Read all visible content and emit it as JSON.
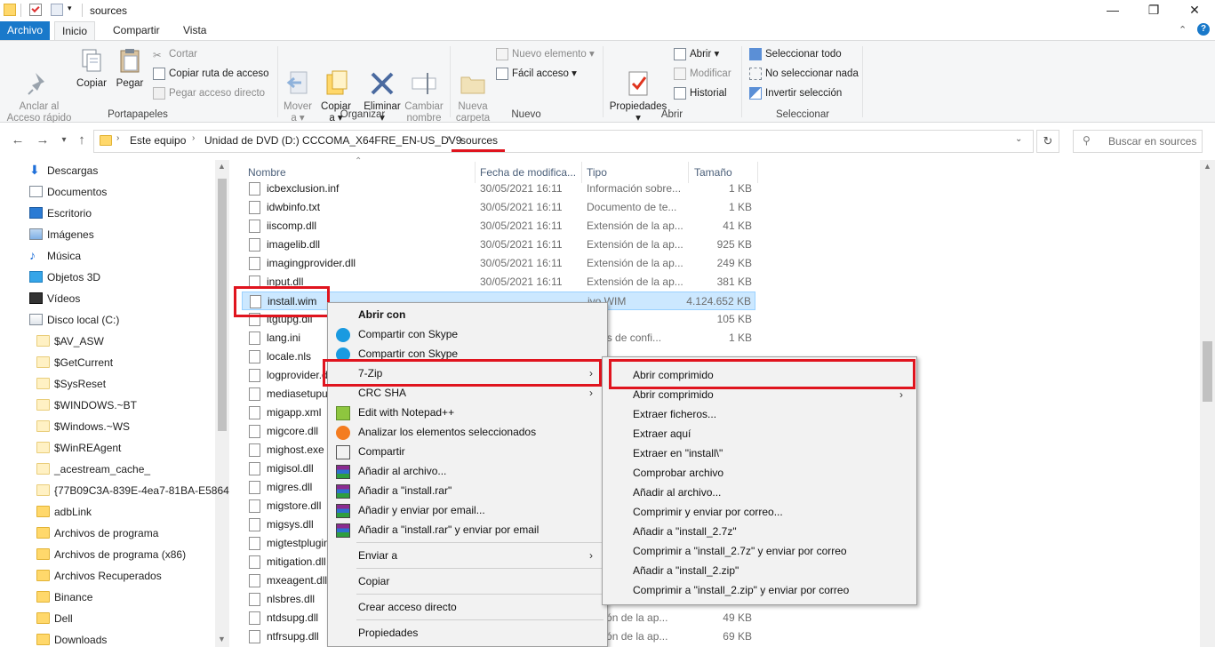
{
  "window": {
    "title": "sources",
    "controls": {
      "minimize": "—",
      "maximize": "❐",
      "close": "✕"
    }
  },
  "ribbon": {
    "tabs": [
      "Archivo",
      "Inicio",
      "Compartir",
      "Vista"
    ],
    "groups": {
      "portapapeles": {
        "label": "Portapapeles",
        "pin": "Anclar al\nAcceso rápido",
        "copy": "Copiar",
        "paste": "Pegar",
        "cut": "Cortar",
        "copy_path": "Copiar ruta de acceso",
        "paste_shortcut": "Pegar acceso directo"
      },
      "organizar": {
        "label": "Organizar",
        "move": "Mover\na ▾",
        "copy_to": "Copiar\na ▾",
        "delete": "Eliminar\n▾",
        "rename": "Cambiar\nnombre"
      },
      "nuevo": {
        "label": "Nuevo",
        "new_folder": "Nueva\ncarpeta",
        "new_item": "Nuevo elemento ▾",
        "easy_access": "Fácil acceso ▾"
      },
      "abrir": {
        "label": "Abrir",
        "properties": "Propiedades\n▾",
        "open": "Abrir ▾",
        "edit": "Modificar",
        "history": "Historial"
      },
      "seleccionar": {
        "label": "Seleccionar",
        "select_all": "Seleccionar todo",
        "select_none": "No seleccionar nada",
        "invert": "Invertir selección"
      }
    }
  },
  "address": {
    "crumbs": [
      "Este equipo",
      "Unidad de DVD (D:) CCCOMA_X64FRE_EN-US_DV9",
      "sources"
    ],
    "search_placeholder": "Buscar en sources"
  },
  "nav_pane": {
    "items": [
      {
        "label": "Descargas",
        "icon": "download-icon"
      },
      {
        "label": "Documentos",
        "icon": "documents-icon"
      },
      {
        "label": "Escritorio",
        "icon": "desktop-icon"
      },
      {
        "label": "Imágenes",
        "icon": "pictures-icon"
      },
      {
        "label": "Música",
        "icon": "music-icon"
      },
      {
        "label": "Objetos 3D",
        "icon": "3d-objects-icon"
      },
      {
        "label": "Vídeos",
        "icon": "videos-icon"
      },
      {
        "label": "Disco local (C:)",
        "icon": "drive-icon"
      },
      {
        "label": "$AV_ASW",
        "icon": "folder-light-icon"
      },
      {
        "label": "$GetCurrent",
        "icon": "folder-light-icon"
      },
      {
        "label": "$SysReset",
        "icon": "folder-light-icon"
      },
      {
        "label": "$WINDOWS.~BT",
        "icon": "folder-light-icon"
      },
      {
        "label": "$Windows.~WS",
        "icon": "folder-light-icon"
      },
      {
        "label": "$WinREAgent",
        "icon": "folder-light-icon"
      },
      {
        "label": "_acestream_cache_",
        "icon": "folder-light-icon"
      },
      {
        "label": "{77B09C3A-839E-4ea7-81BA-E5864",
        "icon": "folder-light-icon"
      },
      {
        "label": "adbLink",
        "icon": "folder-icon"
      },
      {
        "label": "Archivos de programa",
        "icon": "folder-icon"
      },
      {
        "label": "Archivos de programa (x86)",
        "icon": "folder-icon"
      },
      {
        "label": "Archivos Recuperados",
        "icon": "folder-icon"
      },
      {
        "label": "Binance",
        "icon": "folder-icon"
      },
      {
        "label": "Dell",
        "icon": "folder-icon"
      },
      {
        "label": "Downloads",
        "icon": "folder-icon"
      }
    ]
  },
  "file_list": {
    "columns": [
      "Nombre",
      "Fecha de modifica...",
      "Tipo",
      "Tamaño"
    ],
    "rows": [
      {
        "name": "icbexclusion.inf",
        "date": "30/05/2021 16:11",
        "type": "Información sobre...",
        "size": "1 KB"
      },
      {
        "name": "idwbinfo.txt",
        "date": "30/05/2021 16:11",
        "type": "Documento de te...",
        "size": "1 KB"
      },
      {
        "name": "iiscomp.dll",
        "date": "30/05/2021 16:11",
        "type": "Extensión de la ap...",
        "size": "41 KB"
      },
      {
        "name": "imagelib.dll",
        "date": "30/05/2021 16:11",
        "type": "Extensión de la ap...",
        "size": "925 KB"
      },
      {
        "name": "imagingprovider.dll",
        "date": "30/05/2021 16:11",
        "type": "Extensión de la ap...",
        "size": "249 KB"
      },
      {
        "name": "input.dll",
        "date": "30/05/2021 16:11",
        "type": "Extensión de la ap...",
        "size": "381 KB"
      },
      {
        "name": "install.wim",
        "date": "",
        "type": "ivo WIM",
        "size": "4.124.652 KB"
      },
      {
        "name": "itgtupg.dll",
        "date": "",
        "type": "",
        "size": "105 KB"
      },
      {
        "name": "lang.ini",
        "date": "",
        "type": "iones de confi...",
        "size": "1 KB"
      },
      {
        "name": "locale.nls",
        "date": "",
        "type": "",
        "size": ""
      },
      {
        "name": "logprovider.dll",
        "date": "",
        "type": "",
        "size": ""
      },
      {
        "name": "mediasetupui",
        "date": "",
        "type": "",
        "size": ""
      },
      {
        "name": "migapp.xml",
        "date": "",
        "type": "",
        "size": ""
      },
      {
        "name": "migcore.dll",
        "date": "",
        "type": "",
        "size": ""
      },
      {
        "name": "mighost.exe",
        "date": "",
        "type": "",
        "size": ""
      },
      {
        "name": "migisol.dll",
        "date": "",
        "type": "",
        "size": ""
      },
      {
        "name": "migres.dll",
        "date": "",
        "type": "",
        "size": ""
      },
      {
        "name": "migstore.dll",
        "date": "",
        "type": "",
        "size": ""
      },
      {
        "name": "migsys.dll",
        "date": "",
        "type": "",
        "size": ""
      },
      {
        "name": "migtestplugin",
        "date": "",
        "type": "",
        "size": ""
      },
      {
        "name": "mitigation.dll",
        "date": "",
        "type": "",
        "size": ""
      },
      {
        "name": "mxeagent.dll",
        "date": "",
        "type": "",
        "size": ""
      },
      {
        "name": "nlsbres.dll",
        "date": "",
        "type": "",
        "size": ""
      },
      {
        "name": "ntdsupg.dll",
        "date": "",
        "type": "ensión de la ap...",
        "size": "49 KB"
      },
      {
        "name": "ntfrsupg.dll",
        "date": "",
        "type": "ensión de la ap...",
        "size": "69 KB"
      }
    ]
  },
  "context_menu": {
    "items": [
      {
        "label": "Abrir con",
        "bold": true,
        "icon": ""
      },
      {
        "label": "Compartir con Skype",
        "icon": "skype-icon"
      },
      {
        "label": "Compartir con Skype",
        "icon": "skype-icon"
      },
      {
        "label": "7-Zip",
        "icon": "",
        "submenu": true
      },
      {
        "label": "CRC SHA",
        "icon": "",
        "submenu": true
      },
      {
        "label": "Edit with Notepad++",
        "icon": "notepad-icon"
      },
      {
        "label": "Analizar los elementos seleccionados",
        "icon": "avast-icon"
      },
      {
        "label": "Compartir",
        "icon": "share-icon"
      },
      {
        "label": "Añadir al archivo...",
        "icon": "winrar-icon"
      },
      {
        "label": "Añadir a \"install.rar\"",
        "icon": "winrar-icon"
      },
      {
        "label": "Añadir y enviar por email...",
        "icon": "winrar-icon"
      },
      {
        "label": "Añadir a \"install.rar\" y enviar por email",
        "icon": "winrar-icon"
      },
      {
        "label": "Enviar a",
        "icon": "",
        "submenu": true
      },
      {
        "label": "Copiar",
        "icon": ""
      },
      {
        "label": "Crear acceso directo",
        "icon": ""
      },
      {
        "label": "Propiedades",
        "icon": ""
      }
    ]
  },
  "submenu_7zip": {
    "items": [
      {
        "label": "Abrir comprimido"
      },
      {
        "label": "Abrir comprimido",
        "submenu": true
      },
      {
        "label": "Extraer ficheros..."
      },
      {
        "label": "Extraer aquí"
      },
      {
        "label": "Extraer en \"install\\\""
      },
      {
        "label": "Comprobar archivo"
      },
      {
        "label": "Añadir al archivo..."
      },
      {
        "label": "Comprimir y enviar por correo..."
      },
      {
        "label": "Añadir a \"install_2.7z\""
      },
      {
        "label": "Comprimir a \"install_2.7z\" y enviar por correo"
      },
      {
        "label": "Añadir a \"install_2.zip\""
      },
      {
        "label": "Comprimir a \"install_2.zip\" y enviar por correo"
      }
    ]
  },
  "colors": {
    "accent": "#1979ca",
    "selection": "#cce8ff",
    "highlight_red": "#e0141e",
    "folder": "#ffd86b"
  }
}
